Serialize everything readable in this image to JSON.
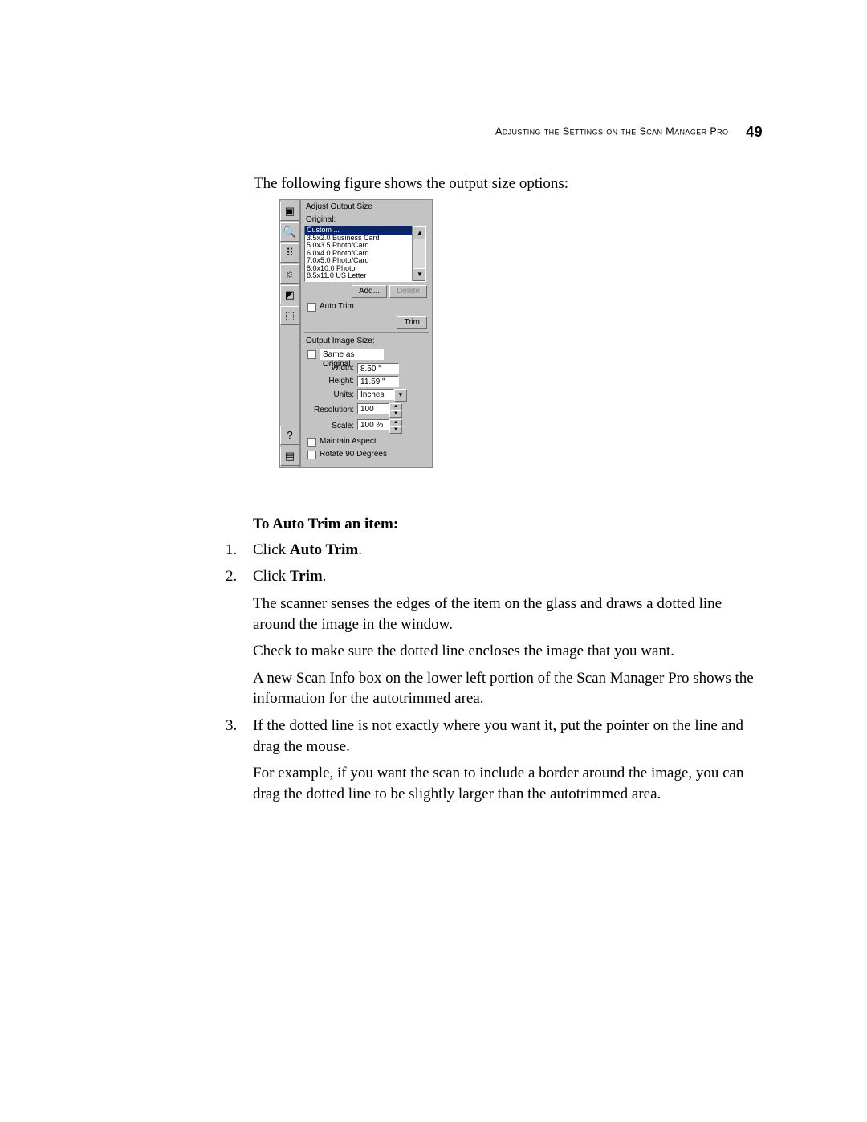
{
  "header": {
    "running_head": "Adjusting the Settings on the Scan Manager Pro",
    "page_number": "49"
  },
  "lead": "The following figure shows the output size options:",
  "figure": {
    "panel_title": "Adjust Output Size",
    "original_label": "Original:",
    "original_options": [
      "Custom ...",
      "3.5x2.0 Business Card",
      "5.0x3.5 Photo/Card",
      "6.0x4.0 Photo/Card",
      "7.0x5.0 Photo/Card",
      "8.0x10.0 Photo",
      "8.5x11.0 US Letter"
    ],
    "add_button": "Add...",
    "delete_button": "Delete",
    "auto_trim_label": "Auto Trim",
    "trim_button": "Trim",
    "output_size_label": "Output Image Size:",
    "same_as_original_label": "Same as Original",
    "width_label": "Width:",
    "width_value": "8.50 \"",
    "height_label": "Height:",
    "height_value": "11.59 \"",
    "units_label": "Units:",
    "units_value": "Inches",
    "resolution_label": "Resolution:",
    "resolution_value": "100",
    "scale_label": "Scale:",
    "scale_value": "100 %",
    "maintain_aspect_label": "Maintain Aspect",
    "rotate_label": "Rotate 90 Degrees"
  },
  "body": {
    "subhead": "To Auto Trim an item:",
    "step1_prefix": "Click ",
    "step1_bold": "Auto Trim",
    "step1_suffix": ".",
    "step2_prefix": "Click ",
    "step2_bold": "Trim",
    "step2_suffix": ".",
    "step2_p1": "The scanner senses the edges of the item on the glass and draws a dotted line around the image in the window.",
    "step2_p2": "Check to make sure the dotted line encloses the image that you want.",
    "step2_p3": "A new Scan Info box on the lower left portion of the Scan Manager Pro shows the information for the autotrimmed area.",
    "step3_p1": "If the dotted line is not exactly where you want it, put the pointer on the line and drag the mouse.",
    "step3_p2": "For example, if you want the scan to include a border around the image, you can drag the dotted line to be slightly larger than the autotrimmed area."
  }
}
